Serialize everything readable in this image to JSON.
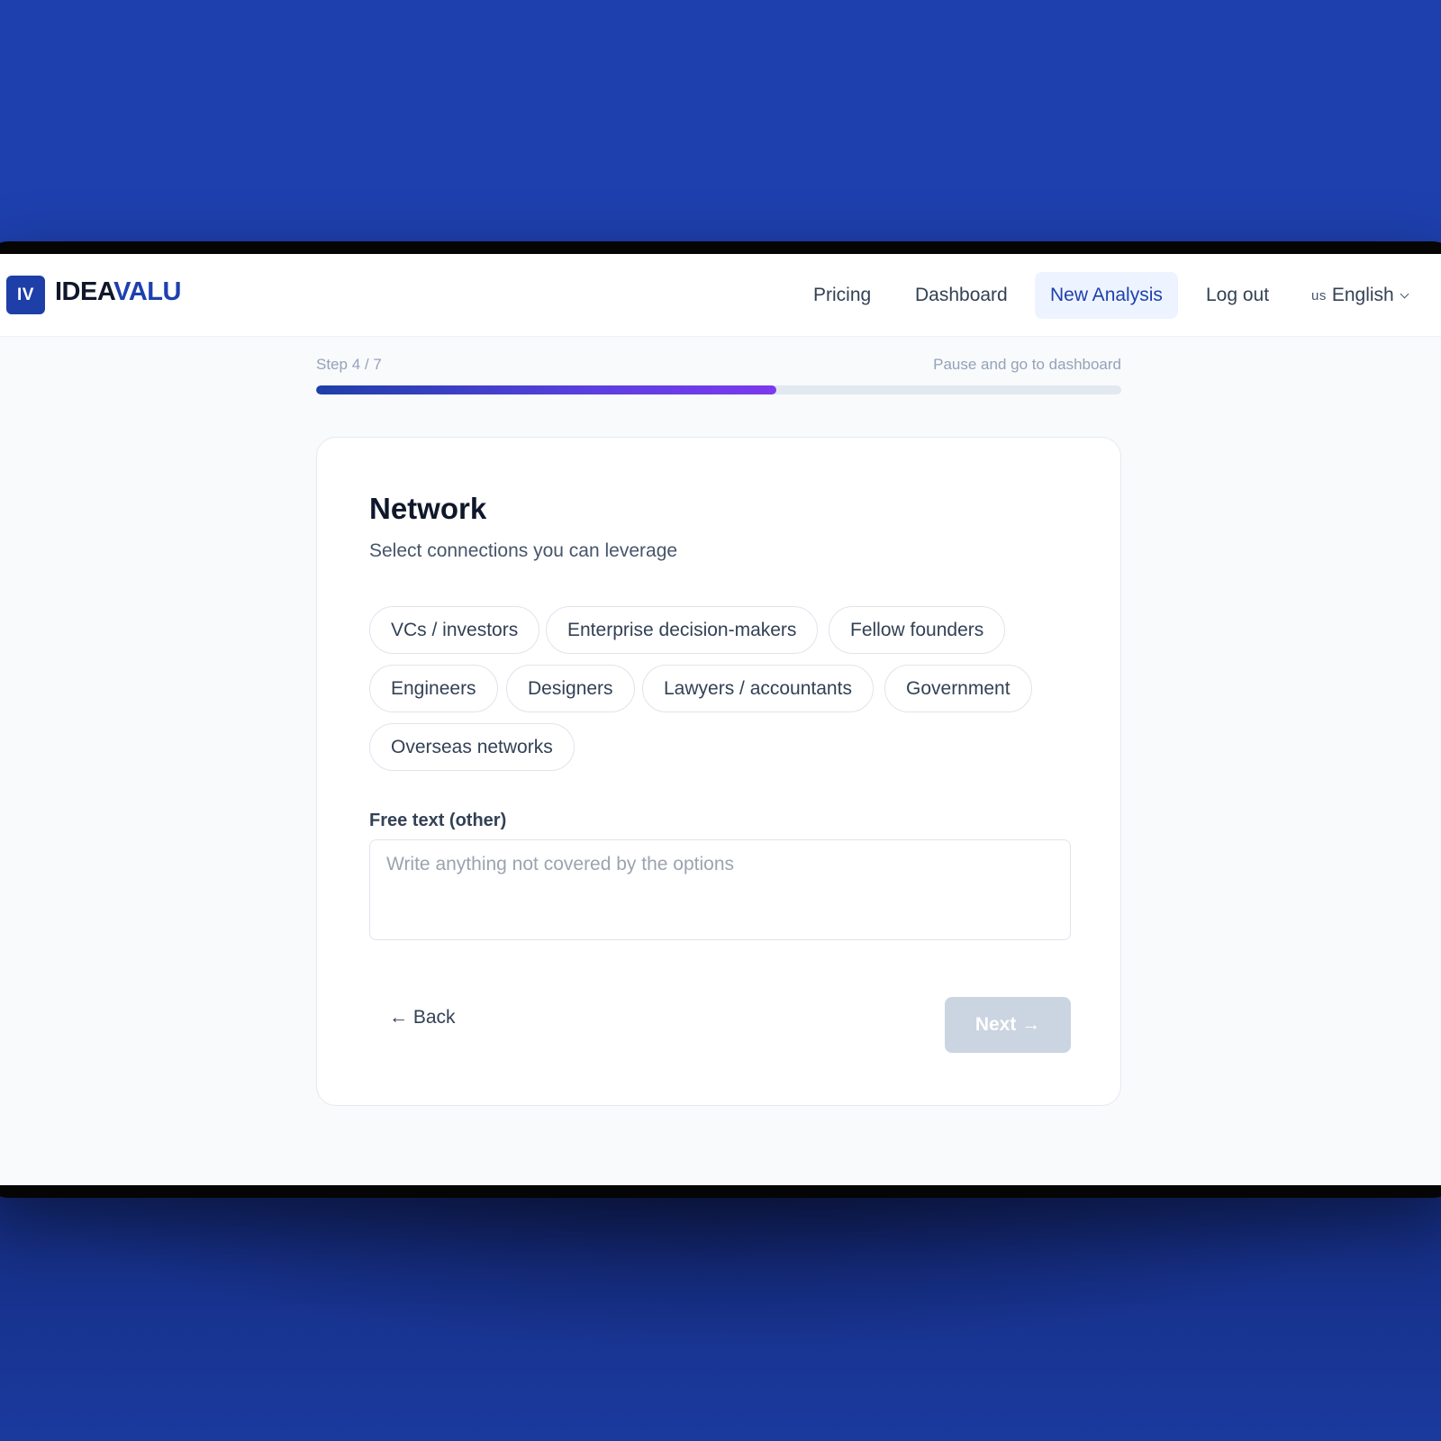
{
  "header": {
    "logo_mark": "IV",
    "logo_part1": "IDEA",
    "logo_part2": "VALU",
    "nav": [
      {
        "label": "Pricing"
      },
      {
        "label": "Dashboard"
      },
      {
        "label": "New Analysis",
        "active": true
      },
      {
        "label": "Log out"
      }
    ],
    "language": {
      "code": "us",
      "label": "English"
    }
  },
  "progress": {
    "step_label": "Step 4 / 7",
    "pause_label": "Pause and go to dashboard",
    "fraction": 0.572
  },
  "card": {
    "title": "Network",
    "subtitle": "Select connections you can leverage",
    "options": [
      "VCs / investors",
      "Enterprise decision-makers",
      "Fellow founders",
      "Engineers",
      "Designers",
      "Lawyers / accountants",
      "Government",
      "Overseas networks"
    ],
    "free_text_label": "Free text (other)",
    "free_text_placeholder": "Write anything not covered by the options",
    "free_text_value": "",
    "back_label": "← Back",
    "next_label": "Next →"
  },
  "colors": {
    "brand": "#1e40af",
    "progress_end": "#7c3aed",
    "next_disabled": "#cbd5e1"
  }
}
